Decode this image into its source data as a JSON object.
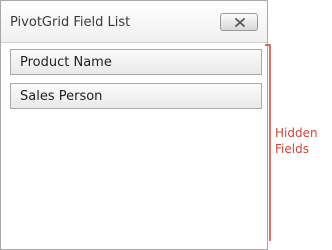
{
  "window": {
    "title": "PivotGrid Field List",
    "close_icon": "close-icon"
  },
  "fields": [
    {
      "label": "Product Name"
    },
    {
      "label": "Sales Person"
    }
  ],
  "annotation": {
    "line1": "Hidden",
    "line2": "Fields",
    "color": "#d0453a"
  }
}
